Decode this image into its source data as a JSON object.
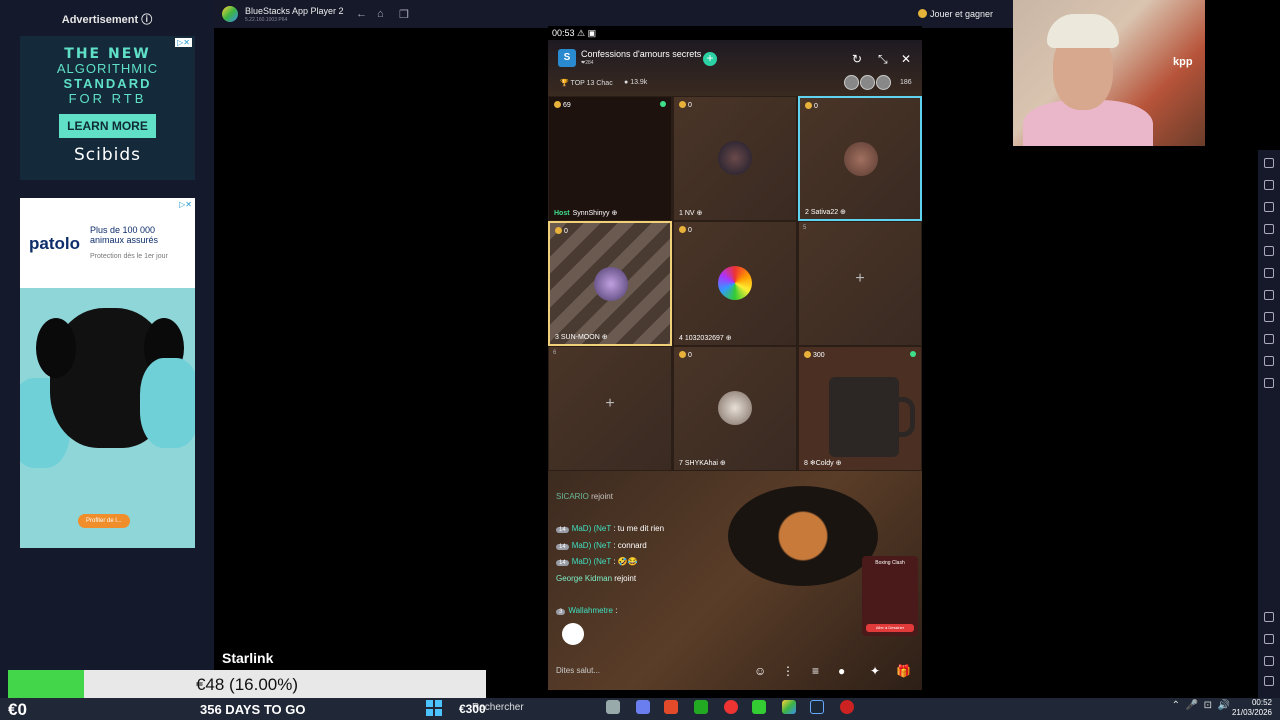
{
  "ads": {
    "heading": "Advertisement ⓘ",
    "scibids": {
      "line1": "THE NEW",
      "line2": "ALGORITHMIC",
      "line3": "STANDARD",
      "line4": "FOR RTB",
      "cta": "LEARN MORE",
      "brand": "Scibids"
    },
    "patolo": {
      "logo": "patolo",
      "tagline": "Plus de 100 000 animaux assurés",
      "sub": "Protection dès le 1er jour",
      "cta": "Profiter de l..."
    }
  },
  "stream": {
    "starlink": "Starlink",
    "progress_text": "€48 (16.00%)",
    "progress_fraction": 0.16,
    "money_left": "€0",
    "days": "356 DAYS TO GO",
    "taskbar_amount": "€300"
  },
  "bluestacks": {
    "title": "BlueStacks App Player 2",
    "version": "5.22.160.1003 P64",
    "play": "Jouer et gagner"
  },
  "taskbar": {
    "search": "Rechercher",
    "time": "00:52",
    "date": "21/03/2026"
  },
  "phone": {
    "status_time": "00:53",
    "room": {
      "initial": "S",
      "name": "Confessions d'amours secrets",
      "sub": "❤284",
      "top": "TOP 13 Chac",
      "fans": "13.9k",
      "viewers": "186"
    },
    "seats": [
      {
        "coins": "69",
        "label": "SynnShinyy",
        "host": "Host"
      },
      {
        "coins": "0",
        "label": "NV",
        "idx": "1"
      },
      {
        "coins": "0",
        "label": "Sativa22",
        "idx": "2"
      },
      {
        "coins": "0",
        "label": "SUN-MOON",
        "idx": "3"
      },
      {
        "coins": "0",
        "label": "1032032697",
        "idx": "4"
      },
      {
        "coins": "5",
        "label": ""
      },
      {
        "coins": "6",
        "label": ""
      },
      {
        "coins": "0",
        "label": "SHYKAhai",
        "idx": "7"
      },
      {
        "coins": "300",
        "label": "❄Coldy",
        "idx": "8"
      }
    ],
    "chat": [
      {
        "user": "SICARIO",
        "text": "rejoint"
      },
      {
        "level": "14",
        "user": "MaD) (NeT",
        "text": ": tu me dit rien"
      },
      {
        "level": "14",
        "user": "MaD) (NeT",
        "text": ": connard"
      },
      {
        "level": "14",
        "user": "MaD) (NeT",
        "text": ": 🤣😂"
      },
      {
        "user": "George Kidman",
        "text": "rejoint"
      },
      {
        "level": "3",
        "user": "Wallahmetre",
        "text": ":"
      }
    ],
    "input_placeholder": "Dites salut...",
    "promo": {
      "title": "Boxing Clash",
      "cta": "Aller à Dessiner"
    }
  }
}
